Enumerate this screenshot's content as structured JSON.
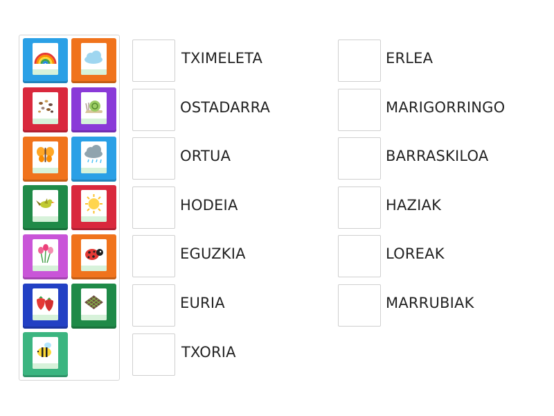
{
  "tile_colors": {
    "blue": "#2aa0e6",
    "orange": "#f0731c",
    "red": "#d9283d",
    "purple": "#8a3ad8",
    "green": "#1f8a48",
    "pink": "#c955d8",
    "navy": "#2240c4",
    "mint": "#3bb580"
  },
  "picture_tiles": [
    {
      "icon": "rainbow-icon",
      "color": "blue"
    },
    {
      "icon": "cloud-icon",
      "color": "orange"
    },
    {
      "icon": "seeds-icon",
      "color": "red"
    },
    {
      "icon": "snail-icon",
      "color": "purple"
    },
    {
      "icon": "butterfly-icon",
      "color": "orange"
    },
    {
      "icon": "rain-cloud-icon",
      "color": "blue"
    },
    {
      "icon": "bird-icon",
      "color": "green"
    },
    {
      "icon": "sun-icon",
      "color": "red"
    },
    {
      "icon": "flowers-icon",
      "color": "pink"
    },
    {
      "icon": "ladybug-icon",
      "color": "orange"
    },
    {
      "icon": "strawberries-icon",
      "color": "navy"
    },
    {
      "icon": "garden-plot-icon",
      "color": "green"
    },
    {
      "icon": "bee-icon",
      "color": "mint"
    }
  ],
  "words": {
    "left": [
      "TXIMELETA",
      "OSTADARRA",
      "ORTUA",
      "HODEIA",
      "EGUZKIA",
      "EURIA",
      "TXORIA"
    ],
    "right": [
      "ERLEA",
      "MARIGORRINGO",
      "BARRASKILOA",
      "HAZIAK",
      "LOREAK",
      "MARRUBIAK"
    ]
  }
}
